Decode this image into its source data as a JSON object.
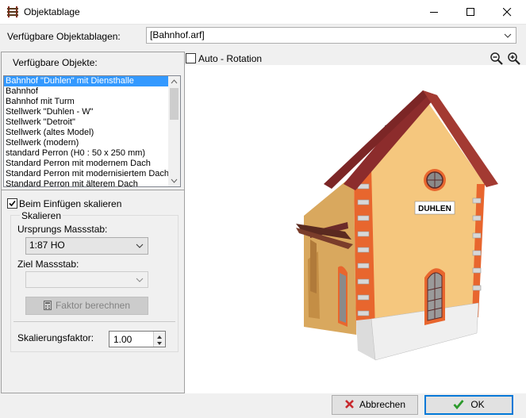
{
  "window": {
    "title": "Objektablage",
    "minimize_icon": "minimize-icon",
    "maximize_icon": "maximize-icon",
    "close_icon": "close-icon"
  },
  "storage": {
    "label": "Verfügbare Objektablagen:",
    "selected": "[Bahnhof.arf]"
  },
  "objects": {
    "label": "Verfügbare Objekte:",
    "items": [
      "Bahnhof \"Duhlen\" mit Diensthalle",
      "Bahnhof",
      "Bahnhof mit Turm",
      "Stellwerk \"Duhlen - W\"",
      "Stellwerk \"Detroit\"",
      "Stellwerk (altes Model)",
      "Stellwerk (modern)",
      "standard Perron (H0 : 50 x 250 mm)",
      "Standard Perron mit modernem Dach",
      "Standard Perron mit modernisiertem Dach",
      "Standard Perron mit älterem Dach"
    ],
    "selected_index": 0
  },
  "scaling": {
    "checkbox_label": "Beim Einfügen skalieren",
    "checked": true,
    "group_title": "Skalieren",
    "source_label": "Ursprungs Massstab:",
    "source_value": "1:87 HO",
    "target_label": "Ziel Massstab:",
    "target_value": "",
    "calc_button": "Faktor berechnen",
    "factor_label": "Skalierungsfaktor:",
    "factor_value": "1.00"
  },
  "viewer": {
    "auto_rotation_label": "Auto - Rotation",
    "auto_rotation_checked": false,
    "zoom_out_icon": "zoom-out-icon",
    "zoom_in_icon": "zoom-in-icon",
    "station_sign": "DUHLEN"
  },
  "actions": {
    "cancel_label": "Abbrechen",
    "ok_label": "OK"
  },
  "colors": {
    "selection": "#3399ff",
    "wall": "#f5c77e",
    "roof": "#8c2c2c",
    "brick": "#e8662e",
    "ok_check": "#2c9a2c",
    "cancel_x": "#c8282d"
  }
}
